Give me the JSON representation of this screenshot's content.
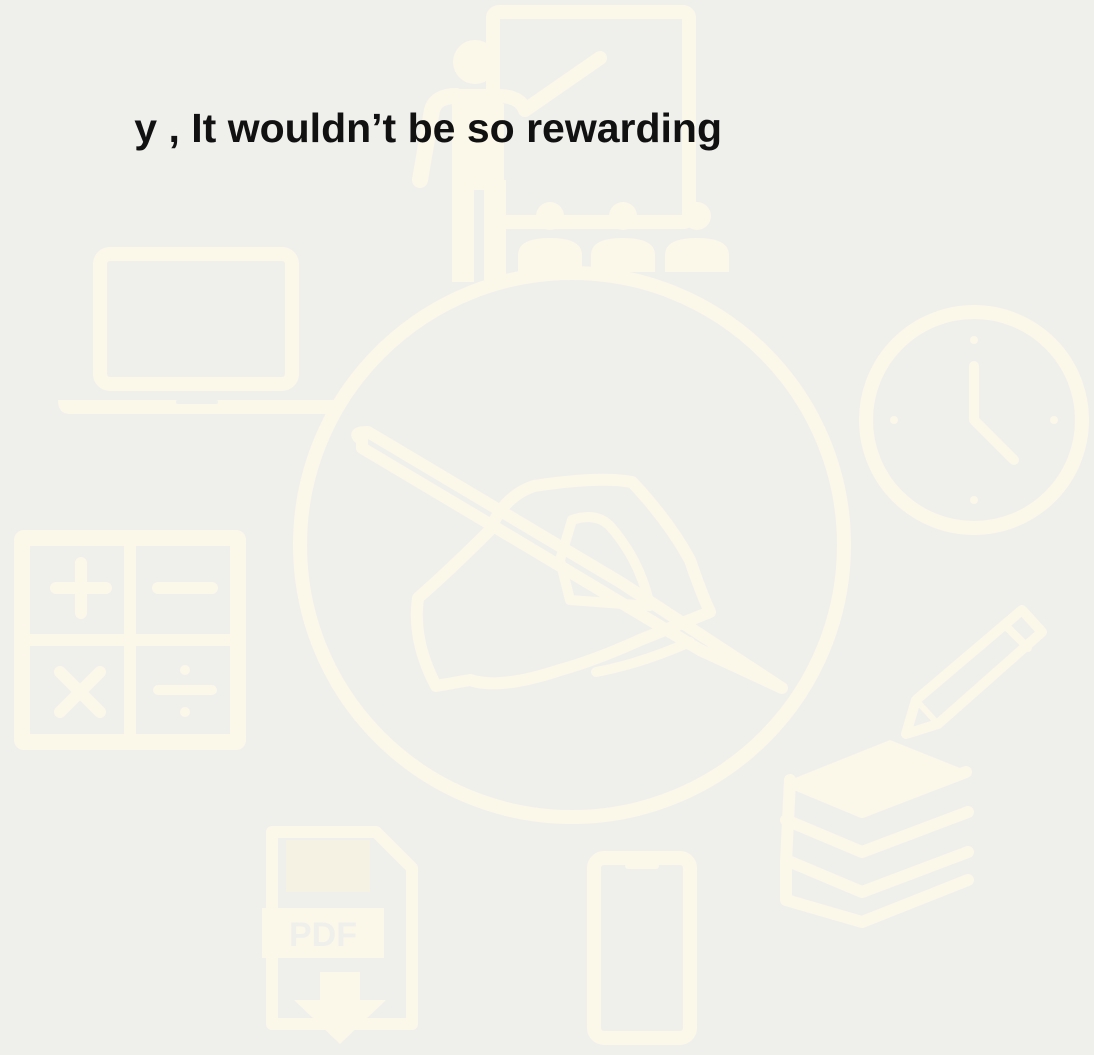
{
  "headline": "y , It wouldn’t be so rewarding",
  "illustration": {
    "icon_color": "#fbf8ea",
    "background_color": "#efefec",
    "icons": [
      "teacher-presentation-icon",
      "audience-icon",
      "laptop-icon",
      "hand-writing-icon",
      "clock-icon",
      "calculator-icon",
      "pencil-icon",
      "books-icon",
      "pdf-download-icon",
      "smartphone-icon"
    ],
    "pdf_label": "PDF"
  }
}
